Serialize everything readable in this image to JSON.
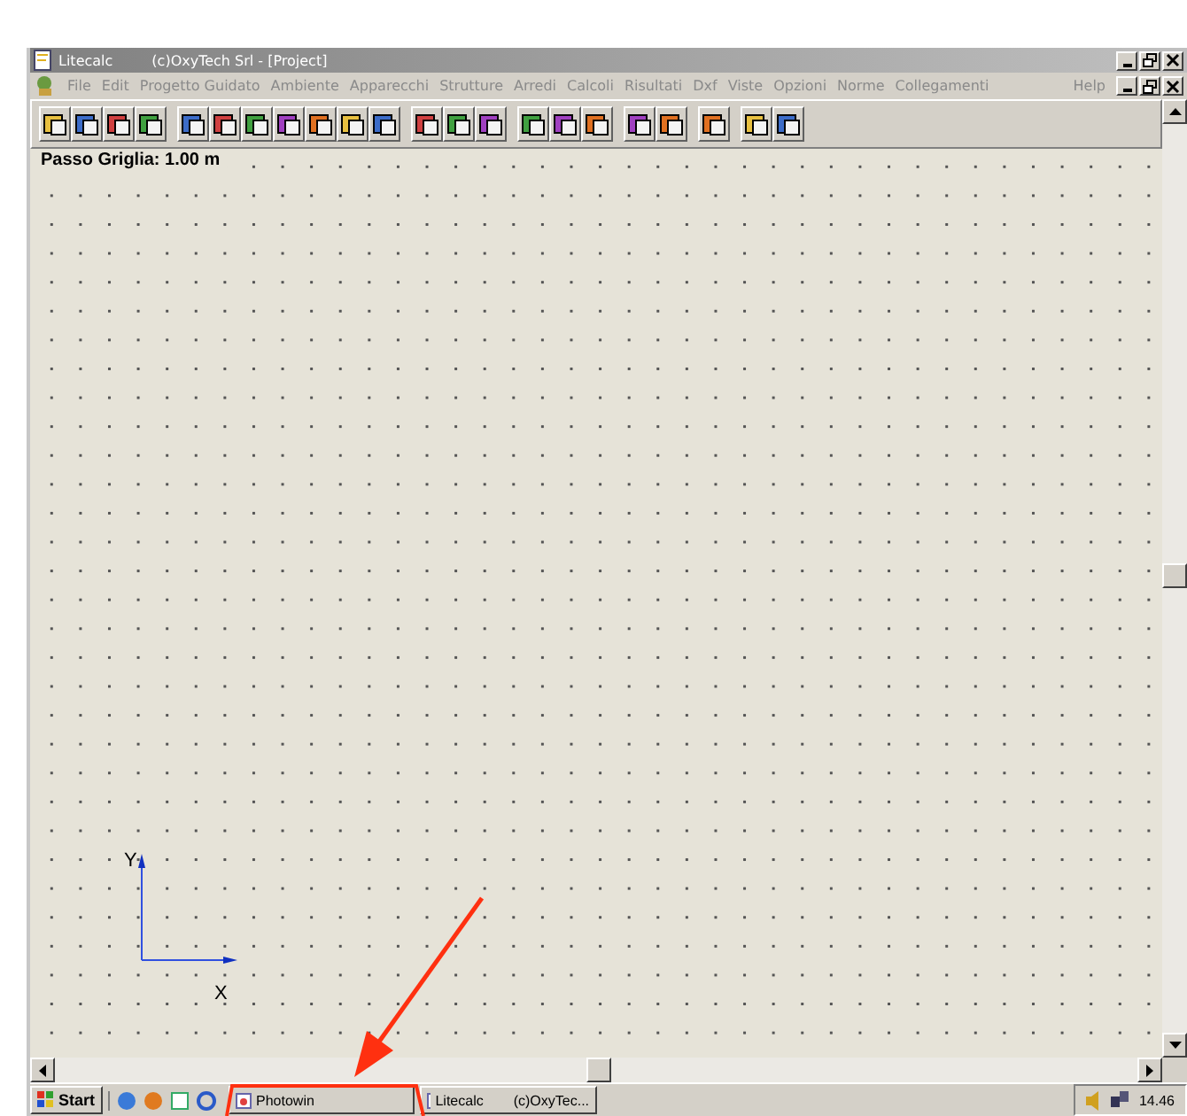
{
  "window": {
    "app_name": "Litecalc",
    "title": "(c)OxyTech Srl - [Project]"
  },
  "menu": {
    "items": [
      "File",
      "Edit",
      "Progetto Guidato",
      "Ambiente",
      "Apparecchi",
      "Strutture",
      "Arredi",
      "Calcoli",
      "Risultati",
      "Dxf",
      "Viste",
      "Opzioni",
      "Norme",
      "Collegamenti"
    ],
    "help": "Help"
  },
  "canvas": {
    "grid_label": "Passo Griglia: 1.00 m",
    "axis_x": "X",
    "axis_y": "Y"
  },
  "taskbar": {
    "start": "Start",
    "tasks": [
      {
        "label": "Photowin"
      },
      {
        "label": "Litecalc",
        "caption": "(c)OxyTec..."
      }
    ],
    "clock": "14.46"
  }
}
